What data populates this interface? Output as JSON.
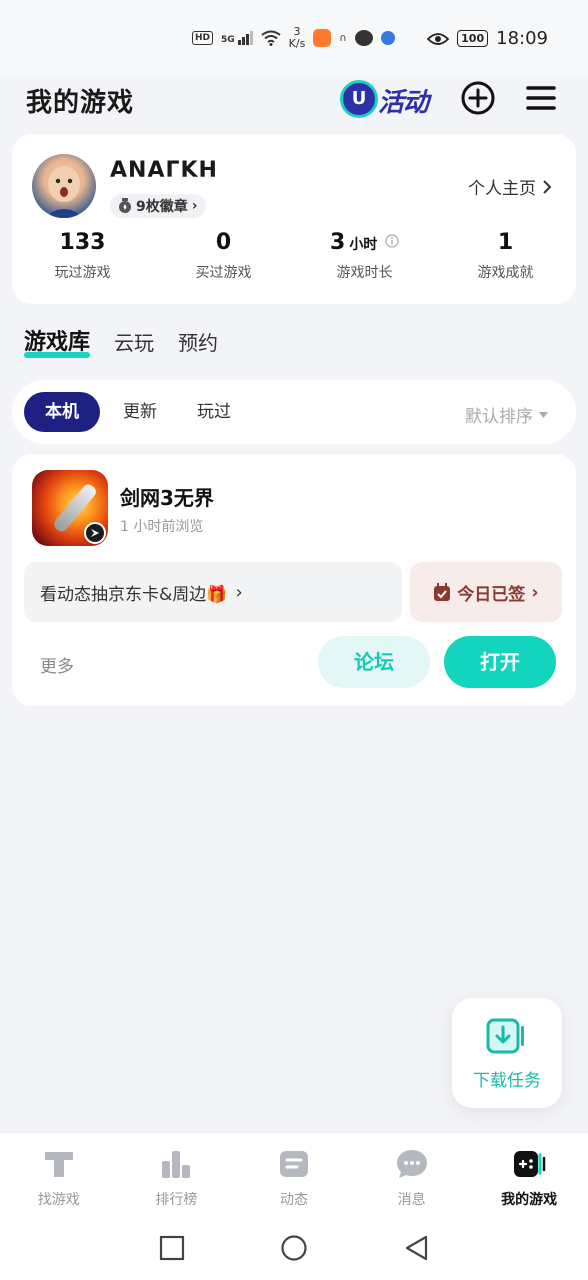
{
  "status_bar": {
    "hd": "HD",
    "signal": "5G",
    "net_speed_value": "3",
    "net_speed_unit": "K/s",
    "battery": "100",
    "time": "18:09"
  },
  "header": {
    "title": "我的游戏",
    "activity_label": "活动"
  },
  "profile": {
    "username": "ΑΝΑΓΚΗ",
    "badges": "9枚徽章",
    "homepage_link": "个人主页",
    "stats": [
      {
        "value": "133",
        "unit": "",
        "label": "玩过游戏"
      },
      {
        "value": "0",
        "unit": "",
        "label": "买过游戏"
      },
      {
        "value": "3",
        "unit": "小时",
        "label": "游戏时长"
      },
      {
        "value": "1",
        "unit": "",
        "label": "游戏成就"
      }
    ]
  },
  "main_tabs": [
    "游戏库",
    "云玩",
    "预约"
  ],
  "filters": {
    "items": [
      "本机",
      "更新",
      "玩过"
    ],
    "sort": "默认排序"
  },
  "game": {
    "name": "剑网3无界",
    "last_browsed": "1 小时前浏览",
    "promo": "看动态抽京东卡&周边🎁",
    "checkin": "今日已签",
    "more": "更多",
    "forum_button": "论坛",
    "open_button": "打开"
  },
  "download_float": {
    "label": "下载任务"
  },
  "bottom_nav": [
    {
      "label": "找游戏",
      "icon": "find-game-icon"
    },
    {
      "label": "排行榜",
      "icon": "ranking-icon"
    },
    {
      "label": "动态",
      "icon": "feed-icon"
    },
    {
      "label": "消息",
      "icon": "message-icon"
    },
    {
      "label": "我的游戏",
      "icon": "my-games-icon"
    }
  ],
  "colors": {
    "accent": "#13d4bd",
    "navy": "#1e2182",
    "background": "#f3f4f7"
  }
}
